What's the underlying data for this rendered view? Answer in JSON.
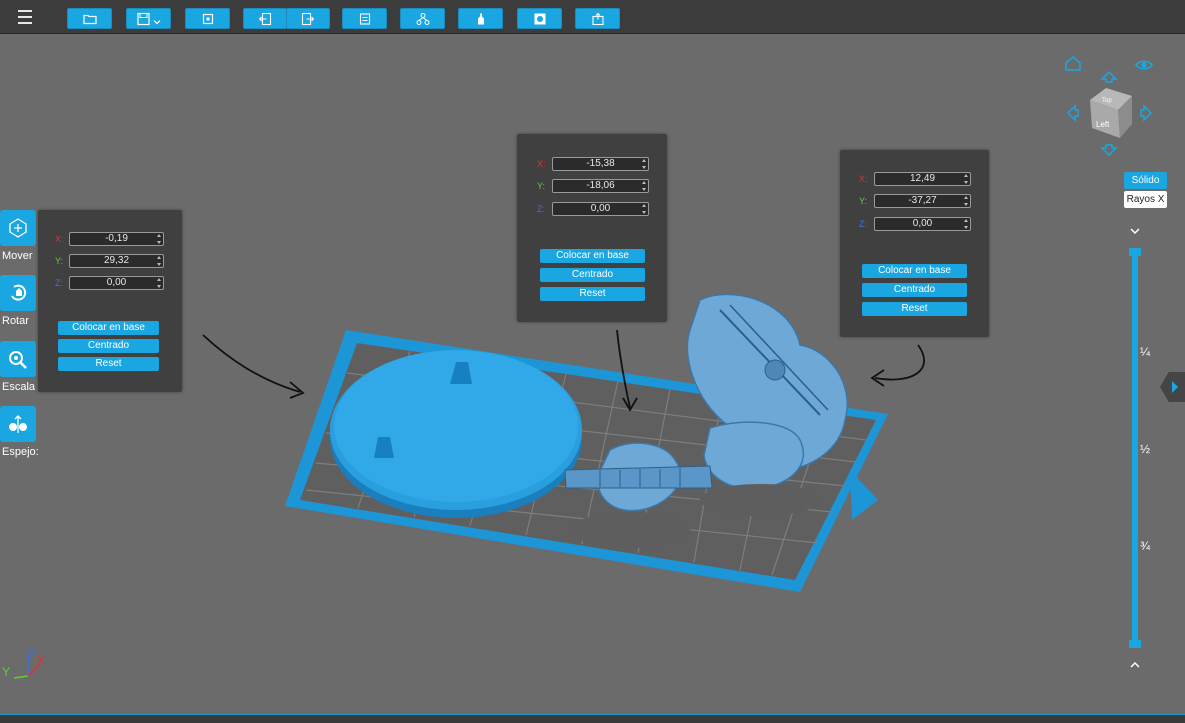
{
  "toolbar": {
    "menu": "hamburger-menu-icon",
    "buttons": [
      "open-folder-icon",
      "save-icon",
      "import-icon",
      "undo-icon",
      "redo-icon",
      "layers-icon",
      "supports-icon",
      "bottle-icon",
      "frame-icon",
      "print-box-icon"
    ]
  },
  "tools": [
    {
      "label": "Mover",
      "icon": "move-icon"
    },
    {
      "label": "Rotar",
      "icon": "rotate-icon"
    },
    {
      "label": "Escala",
      "icon": "scale-icon"
    },
    {
      "label": "Espejo:",
      "icon": "mirror-icon"
    }
  ],
  "panels": {
    "left": {
      "x": "-0,19",
      "y": "29,32",
      "z": "0,00"
    },
    "middle": {
      "x": "-15,38",
      "y": "-18,06",
      "z": "0,00"
    },
    "right": {
      "x": "12,49",
      "y": "-37,27",
      "z": "0,00"
    },
    "axis_labels": {
      "x": "X:",
      "y": "Y:",
      "z": "Z:"
    },
    "buttons": {
      "base": "Colocar en base",
      "center": "Centrado",
      "reset": "Reset"
    }
  },
  "view": {
    "cube_face": "Left",
    "cube_top": "Top",
    "solid": "Sólido",
    "xray": "Rayos X",
    "fractions": [
      "¼",
      "½",
      "¾"
    ]
  },
  "axes_gizmo": {
    "x": "X",
    "y": "Y",
    "z": "Z"
  },
  "colors": {
    "accent": "#1aa6e0",
    "background": "#6b6b6b",
    "panel": "#404040",
    "model": "#1f8fd0"
  }
}
